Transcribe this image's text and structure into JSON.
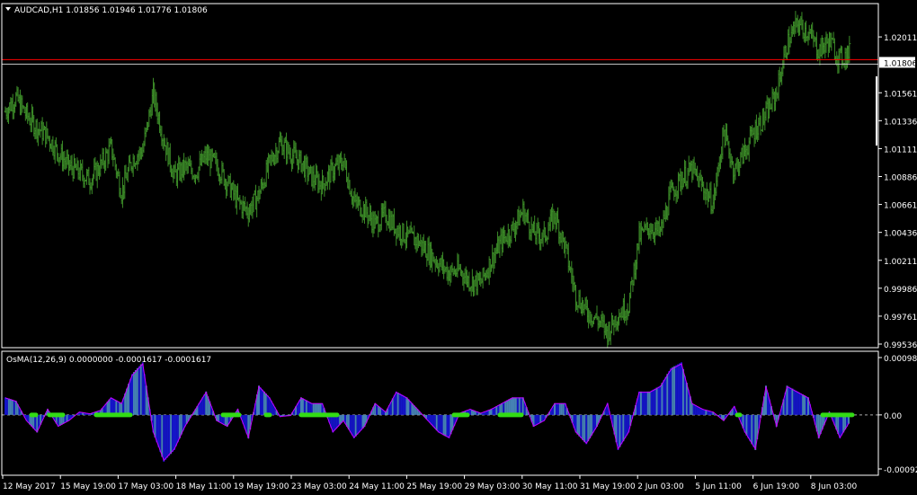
{
  "header": {
    "symbol_line": "AUDCAD,H1  1.01856 1.01946 1.01776 1.01806",
    "indicator_line": "OsMA(12,26,9) 0.0000000 -0.0001617 -0.0001617"
  },
  "colors": {
    "background": "#000000",
    "bars": "#3c8c28",
    "grid_frame": "#ffffff",
    "price_line": "#ff0000",
    "histogram_blue": "#1414c8",
    "histogram_steel": "#4682b4",
    "signal_line": "#c800ff",
    "zero_marker": "#32dc14"
  },
  "chart_data": [
    {
      "type": "ohlc",
      "symbol": "AUDCAD",
      "timeframe": "H1",
      "current_price": "1.01806",
      "y_ticks": [
        "1.02011",
        "1.01806",
        "1.01561",
        "1.01336",
        "1.01111",
        "1.00886",
        "1.00661",
        "1.00436",
        "1.00211",
        "0.99986",
        "0.99761",
        "0.99536"
      ],
      "ylim": [
        0.99536,
        1.02236
      ],
      "close_series": [
        1.0141,
        1.0152,
        1.0138,
        1.0128,
        1.0121,
        1.0108,
        1.0097,
        1.0092,
        1.0086,
        1.0097,
        1.0112,
        1.0076,
        1.0102,
        1.011,
        1.0155,
        1.0118,
        1.0089,
        1.0096,
        1.0092,
        1.0105,
        1.0098,
        1.0084,
        1.0068,
        1.0061,
        1.0074,
        1.0099,
        1.0116,
        1.0107,
        1.01,
        1.0088,
        1.0082,
        1.0094,
        1.0101,
        1.0068,
        1.0062,
        1.005,
        1.0058,
        1.0047,
        1.004,
        1.0037,
        1.0028,
        1.0019,
        1.0011,
        1.0013,
        1.0004,
        1.0003,
        1.0021,
        1.0037,
        1.0046,
        1.0061,
        1.0043,
        1.004,
        1.0058,
        1.0031,
        0.9993,
        0.998,
        0.9974,
        0.9963,
        0.9978,
        0.9985,
        1.004,
        1.0048,
        1.0043,
        1.0075,
        1.0087,
        1.0094,
        1.008,
        1.0067,
        1.0125,
        1.0093,
        1.0109,
        1.0127,
        1.0138,
        1.0156,
        1.0195,
        1.0212,
        1.0205,
        1.019,
        1.0198,
        1.0183,
        1.0189
      ]
    },
    {
      "type": "histogram",
      "title": "OsMA(12,26,9)",
      "y_ticks": [
        "0.0009812",
        "0.00",
        "-0.0009241"
      ],
      "ylim": [
        -0.0009241,
        0.0009812
      ],
      "values": [
        0.0003,
        0.00024,
        -0.0001,
        -0.0003,
        0.0001,
        -0.0002,
        -0.0001,
        5e-05,
        2e-05,
        8e-05,
        0.0003,
        0.0002,
        0.0007,
        0.0009,
        -0.0003,
        -0.0008,
        -0.0006,
        -0.0002,
        0.0001,
        0.0004,
        -0.0001,
        -0.0002,
        0.0001,
        -0.0004,
        0.0005,
        0.0003,
        -3e-05,
        -1e-05,
        0.0003,
        0.0002,
        0.0002,
        -0.0003,
        -0.0001,
        -0.0004,
        -0.0002,
        0.0002,
        5e-05,
        0.0004,
        0.0003,
        0.0001,
        -0.0001,
        -0.0003,
        -0.0004,
        3e-05,
        0.0001,
        3e-05,
        0.0001,
        0.0002,
        0.0003,
        0.0003,
        -0.0002,
        -0.0001,
        0.0002,
        0.0002,
        -0.0003,
        -0.0005,
        -0.0002,
        0.0002,
        -0.0006,
        -0.0003,
        0.0004,
        0.0004,
        0.0005,
        0.0008,
        0.0009,
        0.0002,
        0.0001,
        5e-05,
        -0.0001,
        0.00015,
        -0.0003,
        -0.0006,
        0.0005,
        -0.0002,
        0.0005,
        0.0004,
        0.0003,
        -0.0004,
        5e-05,
        -0.0004,
        -0.0001
      ]
    },
    {
      "type": "time_axis",
      "labels": [
        "12 May 2017",
        "15 May 19:00",
        "17 May 03:00",
        "18 May 11:00",
        "19 May 19:00",
        "23 May 03:00",
        "24 May 11:00",
        "25 May 19:00",
        "29 May 03:00",
        "30 May 11:00",
        "31 May 19:00",
        "2 Jun 03:00",
        "5 Jun 11:00",
        "6 Jun 19:00",
        "8 Jun 03:00"
      ]
    }
  ]
}
